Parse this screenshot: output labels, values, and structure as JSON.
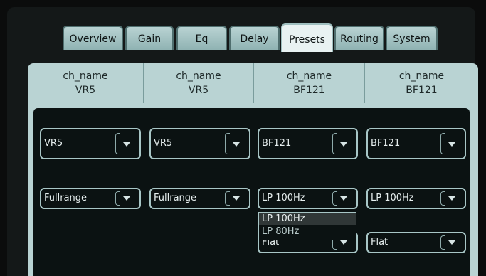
{
  "tabs": [
    "Overview",
    "Gain",
    "Eq",
    "Delay",
    "Presets",
    "Routing",
    "System"
  ],
  "active_tab": "Presets",
  "channels": [
    {
      "name_label": "ch_name",
      "model": "VR5"
    },
    {
      "name_label": "ch_name",
      "model": "VR5"
    },
    {
      "name_label": "ch_name",
      "model": "BF121"
    },
    {
      "name_label": "ch_name",
      "model": "BF121"
    }
  ],
  "speaker_selects": [
    "VR5",
    "VR5",
    "BF121",
    "BF121"
  ],
  "filter_selects": [
    "Fullrange",
    "Fullrange",
    "LP 100Hz",
    "LP 100Hz"
  ],
  "eq_selects": [
    "Flat",
    "Flat"
  ],
  "open_dropdown_options": [
    "LP 100Hz",
    "LP 80Hz"
  ],
  "colors": {
    "background": "#0b0c0c",
    "panel": "#b9d3d3",
    "accent": "#a8c6c6",
    "active_tab": "#e9f2f2"
  }
}
